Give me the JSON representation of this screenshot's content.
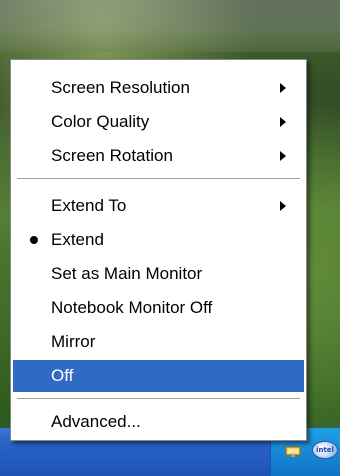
{
  "desktop": {
    "background": "green landscape wallpaper",
    "taskbar_color": "#245ac0",
    "tray_color": "#1889d6"
  },
  "tray": {
    "icons": [
      "monitor-icon",
      "intel-graphics-icon"
    ]
  },
  "context_menu": {
    "highlight_color": "#316ac5",
    "groups": [
      {
        "items": [
          {
            "label": "Screen Resolution",
            "submenu": true
          },
          {
            "label": "Color Quality",
            "submenu": true
          },
          {
            "label": "Screen Rotation",
            "submenu": true
          }
        ]
      },
      {
        "items": [
          {
            "label": "Extend To",
            "submenu": true
          },
          {
            "label": "Extend",
            "checked": true
          },
          {
            "label": "Set as Main Monitor"
          },
          {
            "label": "Notebook Monitor Off"
          },
          {
            "label": "Mirror"
          },
          {
            "label": "Off",
            "selected": true
          }
        ]
      },
      {
        "items": [
          {
            "label": "Advanced..."
          }
        ]
      }
    ]
  }
}
